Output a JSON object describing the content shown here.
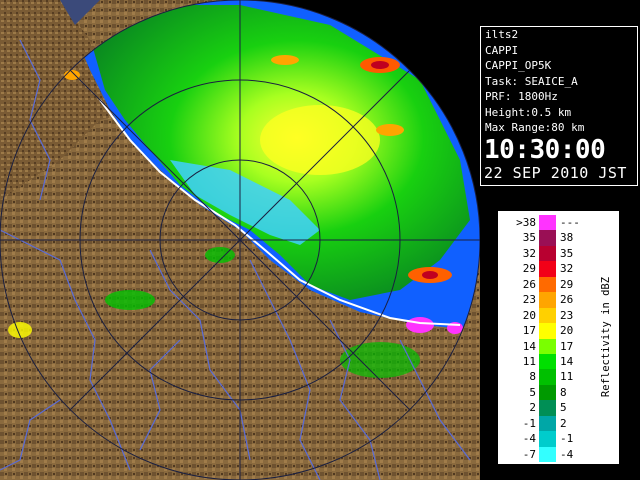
{
  "info": {
    "station": "ilts2",
    "product": "CAPPI",
    "product_id": "CAPPI_OP5K",
    "task": "Task: SEAICE_A",
    "prf": "PRF: 1800Hz",
    "height": "Height:0.5 km",
    "max_range": "Max Range:80 km",
    "time": "10:30:00",
    "date": "22 SEP 2010 JST"
  },
  "legend": {
    "unit": "Reflectivity in dBZ",
    "rows": [
      {
        "low": ">38",
        "high": "---",
        "color": "#ff33ff"
      },
      {
        "low": "35",
        "high": "38",
        "color": "#9a0f55"
      },
      {
        "low": "32",
        "high": "35",
        "color": "#b80030"
      },
      {
        "low": "29",
        "high": "32",
        "color": "#f20018"
      },
      {
        "low": "26",
        "high": "29",
        "color": "#ff6a00"
      },
      {
        "low": "23",
        "high": "26",
        "color": "#ffa500"
      },
      {
        "low": "20",
        "high": "23",
        "color": "#ffd000"
      },
      {
        "low": "17",
        "high": "20",
        "color": "#ffff00"
      },
      {
        "low": "14",
        "high": "17",
        "color": "#7aff00"
      },
      {
        "low": "11",
        "high": "14",
        "color": "#00e000"
      },
      {
        "low": "8",
        "high": "11",
        "color": "#00c000"
      },
      {
        "low": "5",
        "high": "8",
        "color": "#009a00"
      },
      {
        "low": "2",
        "high": "5",
        "color": "#008f55"
      },
      {
        "low": "-1",
        "high": "2",
        "color": "#00a7a7"
      },
      {
        "low": "-4",
        "high": "-1",
        "color": "#00cccc"
      },
      {
        "low": "-7",
        "high": "-4",
        "color": "#33ffff"
      }
    ]
  },
  "map": {
    "colors": {
      "land": "#8a6a3e",
      "land_dark": "#5c4326",
      "sea": "#1060ff",
      "rivers": "#5a6cd8",
      "grid": "#222a55",
      "coast": "#ffffff",
      "lightblue": "#40d0ff"
    }
  }
}
